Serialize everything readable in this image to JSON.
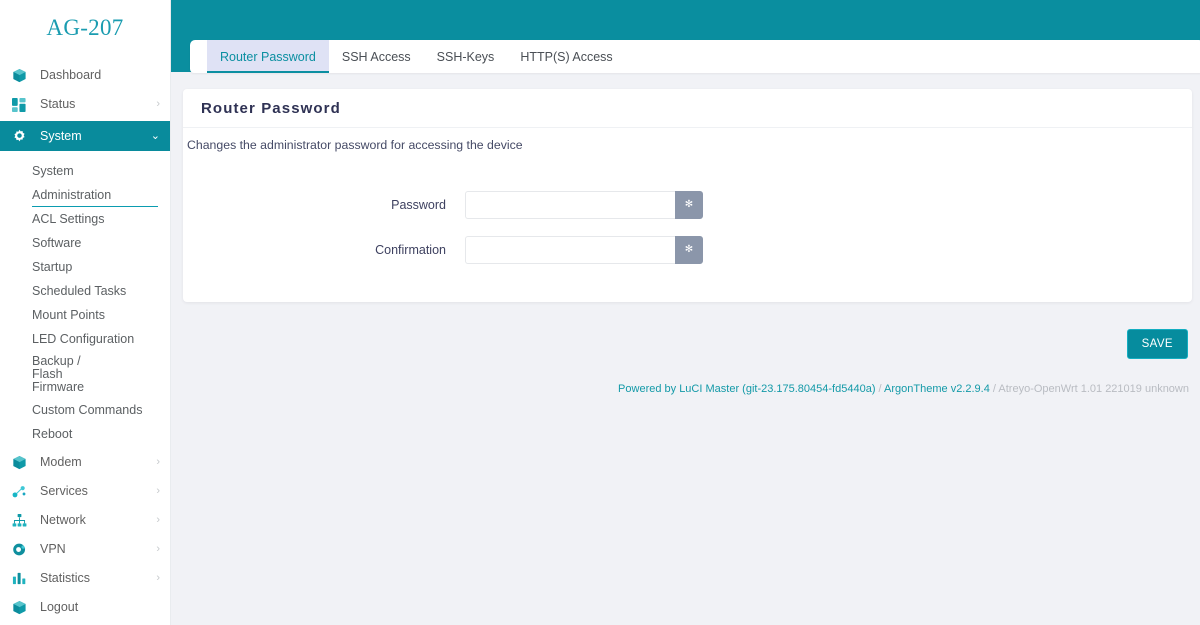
{
  "sidebar": {
    "logo": "AG-207",
    "items": [
      {
        "label": "Dashboard",
        "icon": "cube-icon",
        "name": "dashboard",
        "chevron": "",
        "active": false
      },
      {
        "label": "Status",
        "icon": "grid-icon",
        "name": "status",
        "chevron": "›",
        "active": false
      },
      {
        "label": "System",
        "icon": "gear-icon",
        "name": "system",
        "chevron": "⌄",
        "active": true
      }
    ],
    "sub_items": [
      {
        "label": "System",
        "active": false
      },
      {
        "label": "Administration",
        "active": true
      },
      {
        "label": "ACL Settings",
        "active": false
      },
      {
        "label": "Software",
        "active": false
      },
      {
        "label": "Startup",
        "active": false
      },
      {
        "label": "Scheduled Tasks",
        "active": false
      },
      {
        "label": "Mount Points",
        "active": false
      },
      {
        "label": "LED Configuration",
        "active": false
      },
      {
        "label": "Backup / Flash Firmware",
        "active": false
      },
      {
        "label": "Custom Commands",
        "active": false
      },
      {
        "label": "Reboot",
        "active": false
      }
    ],
    "items_lower": [
      {
        "label": "Modem",
        "icon": "cube-icon",
        "name": "modem",
        "chevron": "›"
      },
      {
        "label": "Services",
        "icon": "nodes-icon",
        "name": "services",
        "chevron": "›"
      },
      {
        "label": "Network",
        "icon": "sitemap-icon",
        "name": "network",
        "chevron": "›"
      },
      {
        "label": "VPN",
        "icon": "globe-icon",
        "name": "vpn",
        "chevron": "›"
      },
      {
        "label": "Statistics",
        "icon": "barchart-icon",
        "name": "statistics",
        "chevron": "›"
      },
      {
        "label": "Logout",
        "icon": "cube-icon",
        "name": "logout",
        "chevron": ""
      }
    ]
  },
  "tabs": [
    {
      "label": "Router Password",
      "active": true
    },
    {
      "label": "SSH Access",
      "active": false
    },
    {
      "label": "SSH-Keys",
      "active": false
    },
    {
      "label": "HTTP(S) Access",
      "active": false
    }
  ],
  "panel": {
    "title": "Router Password",
    "description": "Changes the administrator password for accessing the device",
    "fields": [
      {
        "label": "Password",
        "value": "",
        "placeholder": "",
        "reveal_glyph": "✻"
      },
      {
        "label": "Confirmation",
        "value": "",
        "placeholder": "",
        "reveal_glyph": "✻"
      }
    ]
  },
  "actions": {
    "save_label": "SAVE"
  },
  "footer": {
    "powered": "Powered by LuCI Master (git-23.175.80454-fd5440a)",
    "sep1": " / ",
    "theme": "ArgonTheme v2.2.9.4",
    "sep2": " / ",
    "build": "Atreyo-OpenWrt 1.01 221019 unknown"
  },
  "colors": {
    "accent_teal": "#098b9c",
    "sidebar_bg": "#ffffff",
    "content_bg": "#f1f2f6",
    "tab_active_bg": "#dfe2f5",
    "reveal_btn": "#8b96aa",
    "title_navy": "#2f3254"
  }
}
